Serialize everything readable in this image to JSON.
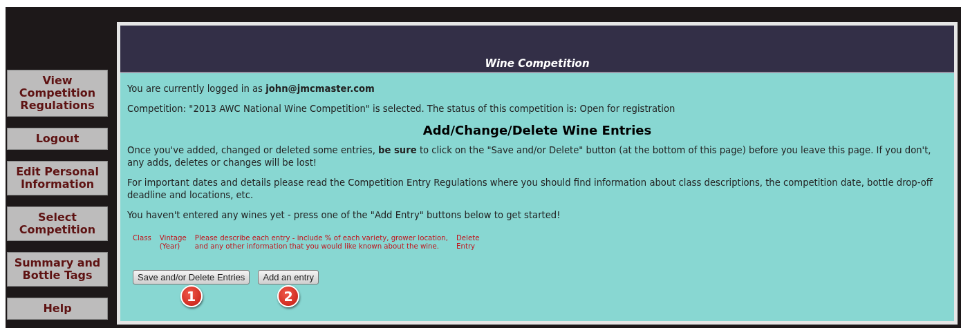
{
  "sidebar": {
    "items": [
      {
        "label": "View Competition Regulations"
      },
      {
        "label": "Logout"
      },
      {
        "label": "Edit Personal Information"
      },
      {
        "label": "Select Competition"
      },
      {
        "label": "Summary and Bottle Tags"
      },
      {
        "label": "Help"
      }
    ]
  },
  "header": {
    "title": "Wine Competition"
  },
  "login_text": "You are currently logged in as **john@jmcmaster.com**",
  "competition_text": "Competition: \"2013 AWC National Wine Competition\" is selected. The status of this competition is: Open for registration",
  "heading": "Add/Change/Delete Wine Entries",
  "paragraphs": [
    "Once you've added, changed or deleted some entries, **be sure** to click on the \"Save and/or Delete\" button (at the bottom of this page) before you leave this page. If you don't, any adds, deletes or changes will be lost!",
    "For important dates and details please read the Competition Entry Regulations where you should find information about class descriptions, the competition date, bottle drop-off deadline and locations, etc.",
    "You haven't entered any wines yet - press one of the \"Add Entry\" buttons below to get started!"
  ],
  "table": {
    "columns": [
      {
        "lines": [
          "Class"
        ]
      },
      {
        "lines": [
          "Vintage",
          "(Year)"
        ]
      },
      {
        "lines": [
          "Please describe each entry - include % of each variety, grower location,",
          "and any other information that you would like known about the wine."
        ]
      },
      {
        "lines": [
          "Delete",
          "Entry"
        ]
      }
    ]
  },
  "buttons": [
    {
      "label": "Save and/or Delete Entries",
      "badge": "1"
    },
    {
      "label": "Add an entry",
      "badge": "2"
    }
  ]
}
